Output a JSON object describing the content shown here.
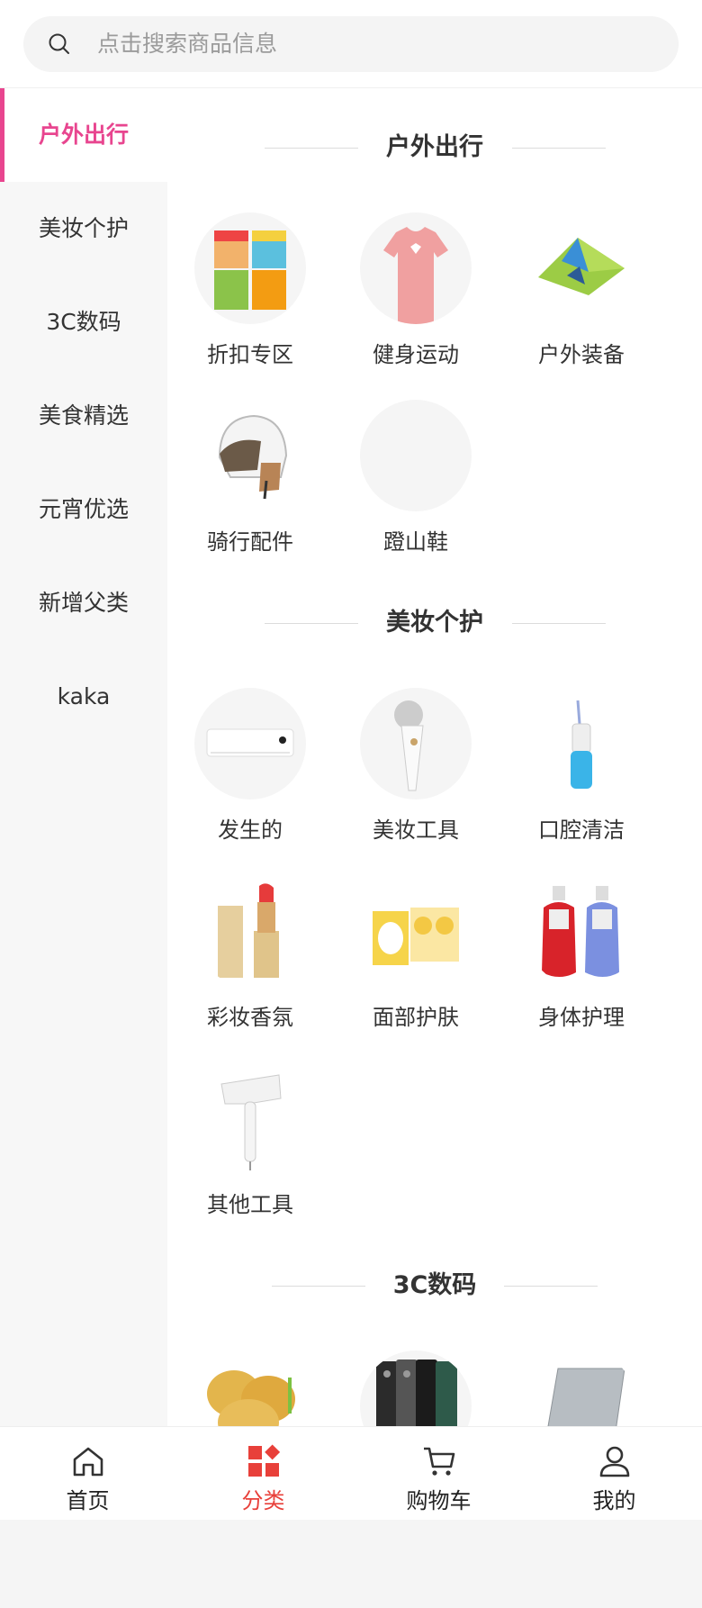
{
  "search": {
    "placeholder": "点击搜索商品信息"
  },
  "sidebar": {
    "items": [
      {
        "label": "户外出行",
        "active": true
      },
      {
        "label": "美妆个护"
      },
      {
        "label": "3C数码"
      },
      {
        "label": "美食精选"
      },
      {
        "label": "元宵优选"
      },
      {
        "label": "新增父类"
      },
      {
        "label": "kaka"
      }
    ]
  },
  "sections": [
    {
      "title": "户外出行",
      "items": [
        {
          "label": "折扣专区",
          "icon": "noodle-cups-image"
        },
        {
          "label": "健身运动",
          "icon": "tshirt-image"
        },
        {
          "label": "户外装备",
          "icon": "tent-image"
        },
        {
          "label": "骑行配件",
          "icon": "helmet-image"
        },
        {
          "label": "蹬山鞋",
          "icon": "empty-image"
        }
      ]
    },
    {
      "title": "美妆个护",
      "items": [
        {
          "label": "发生的",
          "icon": "air-conditioner-image"
        },
        {
          "label": "美妆工具",
          "icon": "face-brush-image"
        },
        {
          "label": "口腔清洁",
          "icon": "water-flosser-image"
        },
        {
          "label": "彩妆香氛",
          "icon": "lipstick-image"
        },
        {
          "label": "面部护肤",
          "icon": "face-mask-image"
        },
        {
          "label": "身体护理",
          "icon": "body-wash-image"
        },
        {
          "label": "其他工具",
          "icon": "hair-dryer-image"
        }
      ]
    },
    {
      "title": "3C数码",
      "items": [
        {
          "label": "",
          "icon": "potatoes-image"
        },
        {
          "label": "",
          "icon": "phones-image"
        },
        {
          "label": "",
          "icon": "tablet-image"
        }
      ]
    }
  ],
  "tabbar": {
    "items": [
      {
        "label": "首页",
        "icon": "home-icon"
      },
      {
        "label": "分类",
        "icon": "category-icon",
        "active": true
      },
      {
        "label": "购物车",
        "icon": "cart-icon"
      },
      {
        "label": "我的",
        "icon": "user-icon"
      }
    ]
  },
  "colors": {
    "accent_pink": "#e8458f",
    "accent_red": "#e8403a",
    "sidebar_bg": "#f7f7f7"
  }
}
